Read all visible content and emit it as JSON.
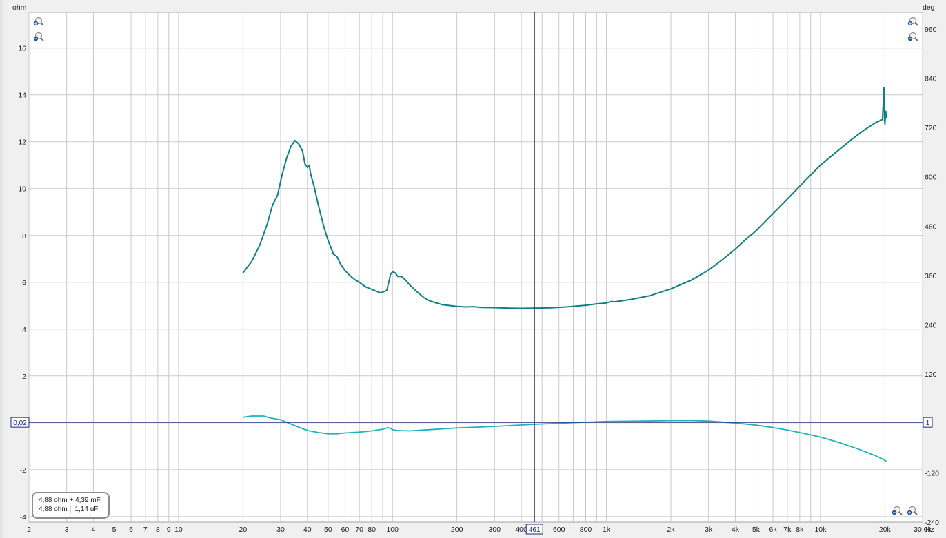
{
  "chart_data": {
    "type": "line",
    "x_scale": "log",
    "x_unit": "Hz",
    "xlim": [
      2,
      30000
    ],
    "x_ticks": [
      {
        "v": 2,
        "label": "2"
      },
      {
        "v": 3,
        "label": "3"
      },
      {
        "v": 4,
        "label": "4"
      },
      {
        "v": 5,
        "label": "5"
      },
      {
        "v": 6,
        "label": "6"
      },
      {
        "v": 7,
        "label": "7"
      },
      {
        "v": 8,
        "label": "8"
      },
      {
        "v": 9,
        "label": "9"
      },
      {
        "v": 10,
        "label": "10"
      },
      {
        "v": 20,
        "label": "20"
      },
      {
        "v": 30,
        "label": "30"
      },
      {
        "v": 40,
        "label": "40"
      },
      {
        "v": 50,
        "label": "50"
      },
      {
        "v": 60,
        "label": "60"
      },
      {
        "v": 70,
        "label": "70"
      },
      {
        "v": 80,
        "label": "80"
      },
      {
        "v": 100,
        "label": "100"
      },
      {
        "v": 200,
        "label": "200"
      },
      {
        "v": 300,
        "label": "300"
      },
      {
        "v": 400,
        "label": "400"
      },
      {
        "v": 600,
        "label": "600"
      },
      {
        "v": 800,
        "label": "800"
      },
      {
        "v": 1000,
        "label": "1k"
      },
      {
        "v": 2000,
        "label": "2k"
      },
      {
        "v": 3000,
        "label": "3k"
      },
      {
        "v": 4000,
        "label": "4k"
      },
      {
        "v": 5000,
        "label": "5k"
      },
      {
        "v": 6000,
        "label": "6k"
      },
      {
        "v": 7000,
        "label": "7k"
      },
      {
        "v": 8000,
        "label": "8k"
      },
      {
        "v": 10000,
        "label": "10k"
      },
      {
        "v": 20000,
        "label": "20k"
      },
      {
        "v": 30000,
        "label": "30,0k"
      }
    ],
    "y_left": {
      "unit": "ohm",
      "range": [
        -4.24,
        17.52
      ],
      "ticks": [
        16,
        14,
        12,
        10,
        8,
        6,
        4,
        2,
        0,
        -2,
        -4
      ]
    },
    "y_right": {
      "unit": "deg",
      "range": [
        -240,
        1000
      ],
      "ticks": [
        960,
        840,
        720,
        600,
        480,
        360,
        240,
        120,
        -120,
        -240
      ]
    },
    "grid": true,
    "cursor": {
      "x": 461,
      "x_label": "461",
      "y": 0.02,
      "y_label": "0,02",
      "right_label": "1"
    },
    "legend": {
      "position": "bottom-left",
      "lines": [
        "4,88 ohm + 4,39 mF",
        "4,88 ohm || 1,14 uF"
      ]
    },
    "series": [
      {
        "axis": "left",
        "color": "#0f8080",
        "points": [
          [
            20,
            6.4
          ],
          [
            22,
            6.9
          ],
          [
            24,
            7.6
          ],
          [
            26,
            8.5
          ],
          [
            27.5,
            9.3
          ],
          [
            29,
            9.7
          ],
          [
            30.5,
            10.6
          ],
          [
            32,
            11.3
          ],
          [
            33.5,
            11.8
          ],
          [
            35,
            12.05
          ],
          [
            36.5,
            11.9
          ],
          [
            38,
            11.6
          ],
          [
            39,
            11.05
          ],
          [
            40,
            10.9
          ],
          [
            40.8,
            11.0
          ],
          [
            41.5,
            10.6
          ],
          [
            43,
            10.1
          ],
          [
            45,
            9.3
          ],
          [
            48,
            8.3
          ],
          [
            50,
            7.8
          ],
          [
            53,
            7.2
          ],
          [
            55,
            7.1
          ],
          [
            57,
            6.8
          ],
          [
            60,
            6.5
          ],
          [
            63,
            6.3
          ],
          [
            67,
            6.1
          ],
          [
            70,
            6.0
          ],
          [
            75,
            5.8
          ],
          [
            80,
            5.7
          ],
          [
            85,
            5.6
          ],
          [
            88,
            5.55
          ],
          [
            91,
            5.6
          ],
          [
            94,
            5.65
          ],
          [
            96,
            6.0
          ],
          [
            98,
            6.35
          ],
          [
            100,
            6.45
          ],
          [
            103,
            6.4
          ],
          [
            106,
            6.25
          ],
          [
            110,
            6.25
          ],
          [
            115,
            6.1
          ],
          [
            120,
            5.9
          ],
          [
            130,
            5.6
          ],
          [
            140,
            5.35
          ],
          [
            150,
            5.2
          ],
          [
            170,
            5.05
          ],
          [
            200,
            4.97
          ],
          [
            220,
            4.95
          ],
          [
            240,
            4.96
          ],
          [
            260,
            4.93
          ],
          [
            300,
            4.92
          ],
          [
            350,
            4.9
          ],
          [
            400,
            4.89
          ],
          [
            461,
            4.9
          ],
          [
            550,
            4.91
          ],
          [
            650,
            4.95
          ],
          [
            800,
            5.02
          ],
          [
            900,
            5.08
          ],
          [
            1000,
            5.12
          ],
          [
            1050,
            5.18
          ],
          [
            1100,
            5.17
          ],
          [
            1300,
            5.27
          ],
          [
            1600,
            5.43
          ],
          [
            2000,
            5.72
          ],
          [
            2500,
            6.1
          ],
          [
            3000,
            6.52
          ],
          [
            3500,
            6.98
          ],
          [
            4000,
            7.42
          ],
          [
            4500,
            7.85
          ],
          [
            4800,
            8.06
          ],
          [
            5000,
            8.2
          ],
          [
            6000,
            8.93
          ],
          [
            7000,
            9.55
          ],
          [
            8000,
            10.1
          ],
          [
            9000,
            10.58
          ],
          [
            10000,
            11.0
          ],
          [
            12000,
            11.6
          ],
          [
            14000,
            12.1
          ],
          [
            16000,
            12.5
          ],
          [
            18000,
            12.8
          ],
          [
            19500,
            12.95
          ],
          [
            19800,
            14.3
          ],
          [
            19900,
            13.0
          ],
          [
            20000,
            12.75
          ],
          [
            20200,
            13.3
          ],
          [
            20300,
            13.0
          ]
        ]
      },
      {
        "axis": "right",
        "color": "#20b2b8",
        "points": [
          [
            20,
            15
          ],
          [
            22,
            18
          ],
          [
            25,
            18
          ],
          [
            27,
            13
          ],
          [
            30,
            9
          ],
          [
            33,
            0
          ],
          [
            36,
            -8
          ],
          [
            40,
            -17
          ],
          [
            45,
            -22
          ],
          [
            50,
            -25
          ],
          [
            55,
            -25
          ],
          [
            60,
            -23
          ],
          [
            70,
            -21
          ],
          [
            80,
            -18
          ],
          [
            90,
            -14
          ],
          [
            95,
            -10
          ],
          [
            98,
            -12
          ],
          [
            100,
            -15
          ],
          [
            105,
            -17
          ],
          [
            120,
            -18
          ],
          [
            150,
            -15
          ],
          [
            200,
            -11
          ],
          [
            300,
            -7
          ],
          [
            461,
            -2
          ],
          [
            700,
            2
          ],
          [
            1000,
            5
          ],
          [
            1500,
            6
          ],
          [
            2000,
            7
          ],
          [
            2500,
            7
          ],
          [
            3000,
            6
          ],
          [
            4000,
            1
          ],
          [
            5000,
            -4
          ],
          [
            6000,
            -10
          ],
          [
            7000,
            -16
          ],
          [
            8000,
            -22
          ],
          [
            10000,
            -33
          ],
          [
            12000,
            -45
          ],
          [
            15000,
            -62
          ],
          [
            18000,
            -78
          ],
          [
            19800,
            -88
          ],
          [
            20000,
            -90
          ],
          [
            20300,
            -92
          ]
        ]
      }
    ]
  }
}
